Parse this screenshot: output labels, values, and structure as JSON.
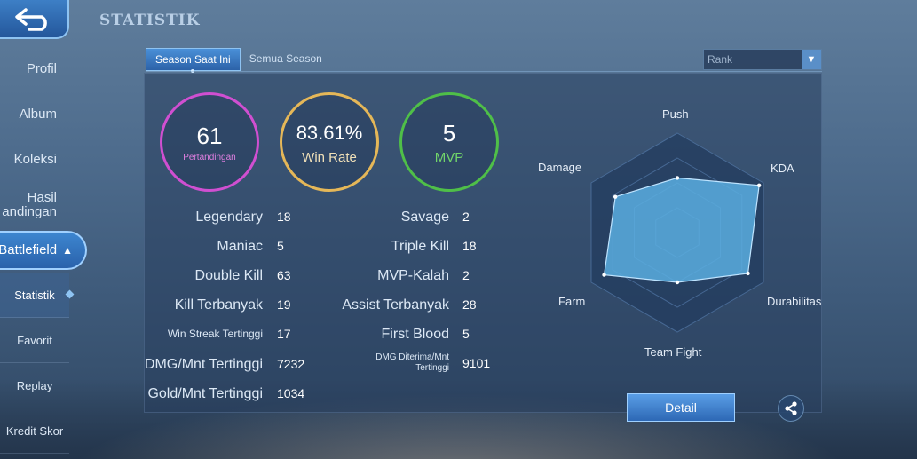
{
  "page_title": "STATISTIK",
  "sidebar": {
    "items": [
      {
        "label": "Profil"
      },
      {
        "label": "Album"
      },
      {
        "label": "Koleksi"
      },
      {
        "label_line1": "Hasil",
        "label_line2": "andingan"
      },
      {
        "label": "Battlefield"
      }
    ],
    "sub_items": [
      {
        "label": "Statistik"
      },
      {
        "label": "Favorit"
      },
      {
        "label": "Replay"
      },
      {
        "label": "Kredit Skor"
      }
    ]
  },
  "tabs": [
    {
      "label": "Season Saat Ini",
      "active": true
    },
    {
      "label": "Semua Season",
      "active": false
    }
  ],
  "mode_select": {
    "value": "Rank"
  },
  "circles": [
    {
      "value": "61",
      "label": "Pertandingan",
      "color": "#d04fd1"
    },
    {
      "value": "83.61%",
      "label": "Win Rate",
      "color": "#e5b758"
    },
    {
      "value": "5",
      "label": "MVP",
      "color": "#4fbf48"
    }
  ],
  "stats_left": [
    {
      "label": "Legendary",
      "value": "18"
    },
    {
      "label": "Maniac",
      "value": "5"
    },
    {
      "label": "Double Kill",
      "value": "63"
    },
    {
      "label": "Kill Terbanyak",
      "value": "19"
    },
    {
      "label": "Win Streak Tertinggi",
      "value": "17"
    },
    {
      "label": "DMG/Mnt Tertinggi",
      "value": "7232"
    },
    {
      "label": "Gold/Mnt Tertinggi",
      "value": "1034"
    }
  ],
  "stats_right": [
    {
      "label": "Savage",
      "value": "2"
    },
    {
      "label": "Triple Kill",
      "value": "18"
    },
    {
      "label": "MVP-Kalah",
      "value": "2"
    },
    {
      "label": "Assist Terbanyak",
      "value": "28"
    },
    {
      "label": "First Blood",
      "value": "5"
    },
    {
      "label_line1": "DMG Diterima/Mnt",
      "label_line2": "Tertinggi",
      "value": "9101"
    }
  ],
  "radar": {
    "axes": [
      "Push",
      "KDA",
      "Durabilitas",
      "Team Fight",
      "Farm",
      "Damage"
    ],
    "values": [
      0.55,
      0.95,
      0.82,
      0.5,
      0.85,
      0.72
    ],
    "fill_color": "#5aaee0"
  },
  "detail_button": {
    "label": "Detail"
  },
  "icons": {
    "back": "back-arrow-icon",
    "share": "share-icon",
    "dropdown": "chevron-down-icon"
  }
}
